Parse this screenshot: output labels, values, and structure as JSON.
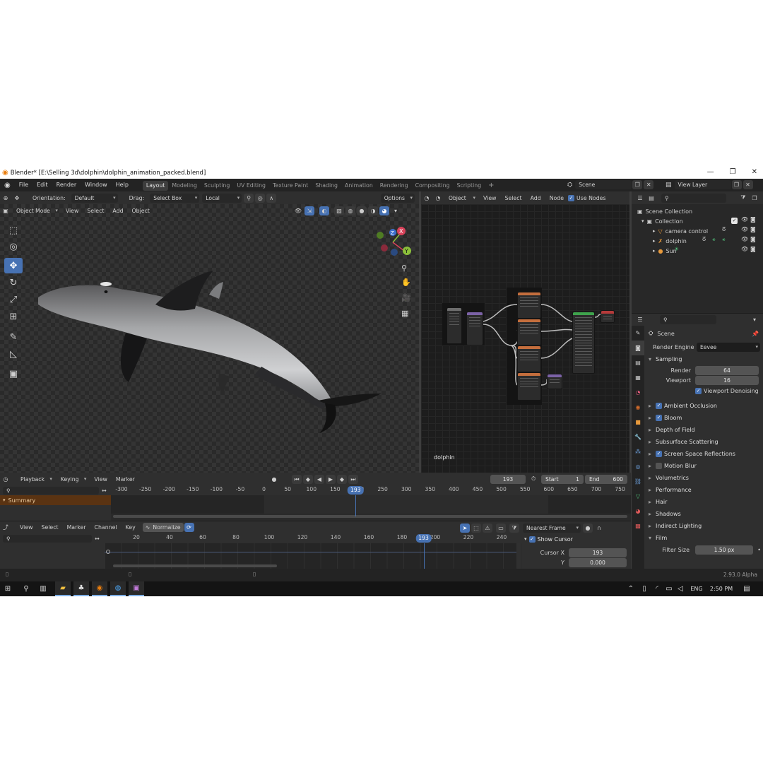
{
  "window": {
    "title": "Blender* [E:\\Selling 3d\\dolphin\\dolphin_animation_packed.blend]",
    "controls": [
      "—",
      "❐",
      "✕"
    ]
  },
  "menubar": {
    "menus": [
      "File",
      "Edit",
      "Render",
      "Window",
      "Help"
    ],
    "workspaces": [
      "Layout",
      "Modeling",
      "Sculpting",
      "UV Editing",
      "Texture Paint",
      "Shading",
      "Animation",
      "Rendering",
      "Compositing",
      "Scripting"
    ],
    "active_workspace": "Layout",
    "add_tab": "+",
    "scene": "Scene",
    "view_layer": "View Layer"
  },
  "viewport_header": {
    "orientation_label": "Orientation:",
    "orientation": "Default",
    "drag_label": "Drag:",
    "drag": "Select Box",
    "pivot": "Local",
    "options": "Options",
    "mode": "Object Mode",
    "menus": [
      "View",
      "Select",
      "Add",
      "Object"
    ]
  },
  "viewport": {
    "gizmo_axes": [
      "Z",
      "X",
      "Y"
    ]
  },
  "node_editor": {
    "object": "Object",
    "menus": [
      "View",
      "Select",
      "Add",
      "Node"
    ],
    "use_nodes_label": "Use Nodes",
    "use_nodes": true,
    "object_name": "dolphin"
  },
  "outliner": {
    "root": "Scene Collection",
    "collection": "Collection",
    "items": [
      {
        "name": "camera control"
      },
      {
        "name": "dolphin"
      },
      {
        "name": "Sun"
      }
    ]
  },
  "properties": {
    "context": "Scene",
    "render_engine_label": "Render Engine",
    "render_engine": "Eevee",
    "sampling": {
      "title": "Sampling",
      "render_label": "Render",
      "render": "64",
      "viewport_label": "Viewport",
      "viewport": "16",
      "denoise_label": "Viewport Denoising"
    },
    "panels": [
      {
        "name": "Ambient Occlusion",
        "checkbox": true,
        "checked": true
      },
      {
        "name": "Bloom",
        "checkbox": true,
        "checked": true
      },
      {
        "name": "Depth of Field",
        "checkbox": false
      },
      {
        "name": "Subsurface Scattering",
        "checkbox": false
      },
      {
        "name": "Screen Space Reflections",
        "checkbox": true,
        "checked": true
      },
      {
        "name": "Motion Blur",
        "checkbox": true,
        "checked": false
      },
      {
        "name": "Volumetrics",
        "checkbox": false
      },
      {
        "name": "Performance",
        "checkbox": false
      },
      {
        "name": "Hair",
        "checkbox": false
      },
      {
        "name": "Shadows",
        "checkbox": false
      },
      {
        "name": "Indirect Lighting",
        "checkbox": false
      }
    ],
    "film": {
      "title": "Film",
      "filter_size_label": "Filter Size",
      "filter_size": "1.50 px"
    }
  },
  "timeline": {
    "menus": [
      "Playback",
      "Keying",
      "View",
      "Marker"
    ],
    "current_frame": "193",
    "start_label": "Start",
    "start": "1",
    "end_label": "End",
    "end": "600",
    "ruler": [
      "-300",
      "-250",
      "-200",
      "-150",
      "-100",
      "-50",
      "0",
      "50",
      "100",
      "150",
      "200",
      "250",
      "300",
      "350",
      "400",
      "450",
      "500",
      "550",
      "600",
      "650",
      "700",
      "750"
    ],
    "summary": "Summary"
  },
  "graph_editor": {
    "menus": [
      "View",
      "Select",
      "Marker",
      "Channel",
      "Key"
    ],
    "normalize": "Normalize",
    "snap": "Nearest Frame",
    "ruler": [
      "20",
      "40",
      "60",
      "80",
      "100",
      "120",
      "140",
      "160",
      "180",
      "200",
      "220",
      "240"
    ],
    "cursor_frame": "193",
    "show_cursor_label": "Show Cursor",
    "cursor_x_label": "Cursor X",
    "cursor_x": "193",
    "cursor_y_label": "Y",
    "cursor_y": "0.000"
  },
  "statusbar": {
    "version": "2.93.0 Alpha"
  },
  "taskbar": {
    "language": "ENG",
    "time": "2:50 PM"
  },
  "colors": {
    "accent": "#4772b3",
    "panel": "#2f2f2f",
    "summary": "#5a3312"
  }
}
